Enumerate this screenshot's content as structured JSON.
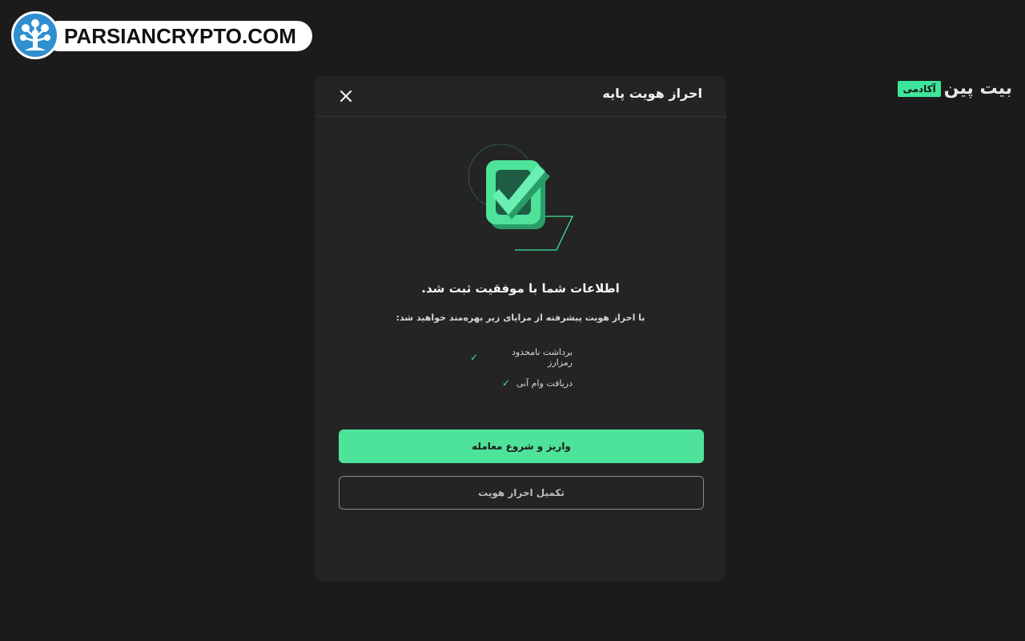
{
  "watermark": {
    "text": "PARSIANCRYPTO.COM",
    "logo_icon": "tree-icon"
  },
  "brand": {
    "name": "بیت پین",
    "badge": "آکادمی",
    "accent_color": "#3ee69a"
  },
  "modal": {
    "title": "احراز هویت پایه",
    "close_icon": "close-icon",
    "illustration_icon": "checkbox-check-icon",
    "headline": "اطلاعات شما با موفقیت ثبت شد.",
    "subline": "با احراز هویت پیشرفته از مزایای زیر بهره‌مند خواهید شد:",
    "features": [
      {
        "label": "برداشت نامحدود رمزارز",
        "icon": "check-icon"
      },
      {
        "label": "دریافت وام آنی",
        "icon": "check-icon"
      }
    ],
    "primary_button": "واریز و شروع معامله",
    "secondary_button": "تکمیل احراز هویت"
  }
}
